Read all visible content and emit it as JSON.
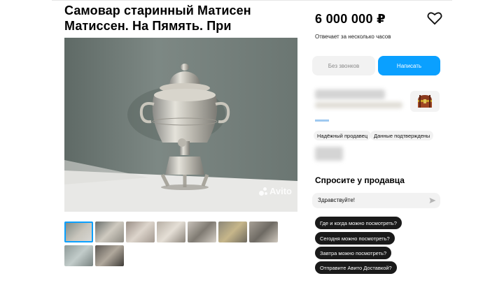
{
  "listing": {
    "title": "Самовар старинный Матисен Матиссен. На Пямять. При",
    "price": "6 000 000 ₽",
    "reply_time": "Отвечает за несколько часов"
  },
  "buttons": {
    "no_calls": "Без звонков",
    "write": "Написать"
  },
  "seller": {
    "badges": [
      "Надёжный продавец",
      "Данные подтверждены"
    ]
  },
  "gallery": {
    "watermark": "Avito",
    "thumb_count": 9,
    "active_index": 0
  },
  "ask": {
    "title": "Спросите у продавца",
    "input_value": "Здравствуйте!",
    "questions": [
      "Где и когда можно посмотреть?",
      "Сегодня можно посмотреть?",
      "Завтра можно посмотреть?",
      "Отправите Авито Доставкой?"
    ]
  },
  "colors": {
    "accent": "#0aa0ff",
    "dark_chip": "#1a1a1a"
  },
  "icons": {
    "favorite": "heart-icon",
    "send": "send-icon",
    "seller_avatar": "treasure-chest-icon"
  }
}
